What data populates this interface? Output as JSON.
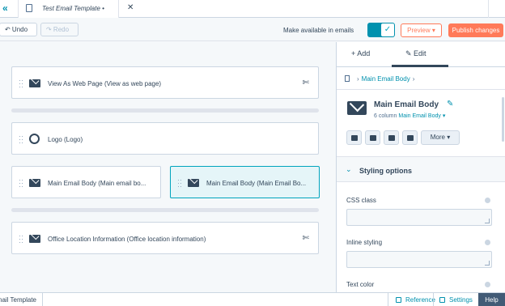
{
  "tabbar": {
    "collapse_icon": "double-chevron-left-icon",
    "doc_title": "Test Email Template •",
    "close_glyph": "✕"
  },
  "toolbar": {
    "undo_label": "↶ Undo",
    "redo_label": "↷ Redo",
    "make_available_label": "Make available in emails",
    "toggle_on": true,
    "toggle_check": "✓",
    "preview_label": "Preview ▾",
    "publish_label": "Publish changes"
  },
  "canvas": {
    "modules": [
      {
        "label": "View As Web Page (View as web page)",
        "icon": "email-icon",
        "pinned": true
      },
      {
        "label": "Logo (Logo)",
        "icon": "logo-icon",
        "pinned": false
      },
      {
        "label": "Main Email Body (Main email bo...",
        "icon": "email-icon",
        "pinned": false
      },
      {
        "label": "Main Email Body (Main Email Bo...",
        "icon": "email-icon",
        "pinned": false,
        "selected": true
      },
      {
        "label": "Office Location Information (Office location information)",
        "icon": "email-icon",
        "pinned": true
      }
    ],
    "pin_glyph": "✄"
  },
  "panel": {
    "tabs": {
      "add": "+  Add",
      "edit": "✎  Edit"
    },
    "active_tab": "Edit",
    "breadcrumb": {
      "item": "Main Email Body"
    },
    "module": {
      "title": "Main Email Body",
      "subtitle_prefix": "6 column",
      "subtitle_link": "Main Email Body ▾"
    },
    "more_label": "More ▾",
    "styling_section": {
      "label": "Styling options",
      "chevron": "⌄"
    },
    "fields": {
      "css_class": "CSS class",
      "inline_styling": "Inline styling",
      "text_color": "Text color"
    }
  },
  "statusbar": {
    "template_name": "nail Template",
    "reference_label": "Reference",
    "settings_label": "Settings",
    "help_label": "Help"
  },
  "colors": {
    "accent": "#0091ae",
    "publish": "#ff7a59",
    "text": "#33475b",
    "selected_bg": "#e5f5f8",
    "help_bg": "#425b76"
  }
}
